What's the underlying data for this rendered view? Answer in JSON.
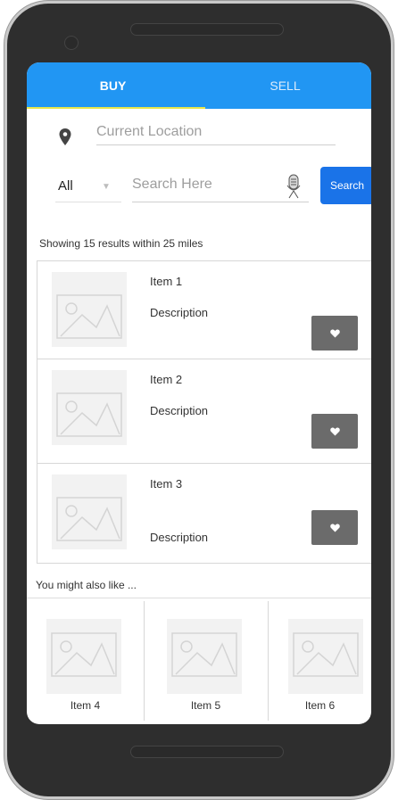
{
  "tabs": {
    "buy": "BUY",
    "sell": "SELL"
  },
  "location": {
    "placeholder": "Current Location",
    "icon": "location-pin-icon"
  },
  "filter": {
    "category": "All"
  },
  "search": {
    "placeholder": "Search Here",
    "button": "Search",
    "mic_icon": "microphone-icon"
  },
  "results_text": "Showing 15 results within 25 miles",
  "items": [
    {
      "title": "Item 1",
      "description": "Description"
    },
    {
      "title": "Item 2",
      "description": "Description"
    },
    {
      "title": "Item 3",
      "description": "Description"
    }
  ],
  "recommend": {
    "heading": "You might also like ...",
    "items": [
      "Item 4",
      "Item 5",
      "Item 6"
    ]
  },
  "colors": {
    "primary": "#2196f3",
    "search_button": "#1a73e8",
    "tab_underline": "#e8e64a",
    "favorite_button": "#6b6b6b"
  }
}
